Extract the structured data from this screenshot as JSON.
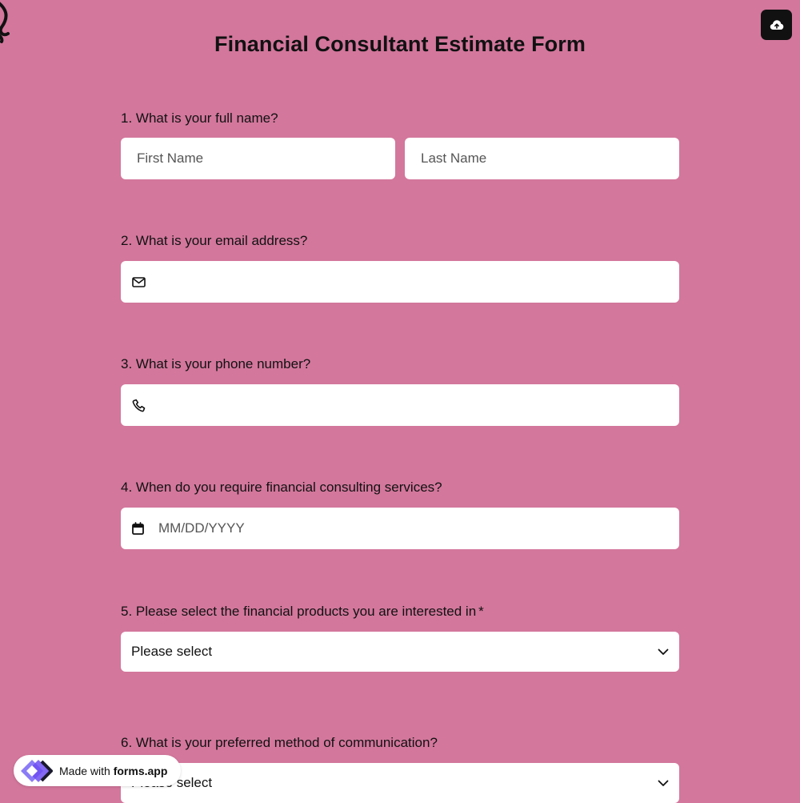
{
  "form": {
    "title": "Financial Consultant Estimate Form"
  },
  "questions": [
    {
      "label": "1.  What is your full name?"
    },
    {
      "label": "2. What is your email address?"
    },
    {
      "label": "3. What is your phone number?"
    },
    {
      "label": "4. When do you require financial consulting services?"
    },
    {
      "label": "5. Please select the financial products you are interested in",
      "required_mark": "*"
    },
    {
      "label": "6. What is your preferred method of communication?"
    }
  ],
  "fields": {
    "first_name_placeholder": "First Name",
    "last_name_placeholder": "Last Name",
    "date_placeholder": "MM/DD/YYYY",
    "select_products_value": "Please select",
    "select_communication_value": "Please select"
  },
  "icons": {
    "upload": "cloud-upload-icon",
    "email": "envelope-icon",
    "phone": "phone-icon",
    "date": "calendar-icon",
    "dropdown": "chevron-down-icon"
  },
  "badge": {
    "prefix": "Made with",
    "brand": "forms.app"
  },
  "colors": {
    "background": "#d3779c",
    "field": "#ffffff",
    "text": "#111111",
    "button": "#111111"
  }
}
